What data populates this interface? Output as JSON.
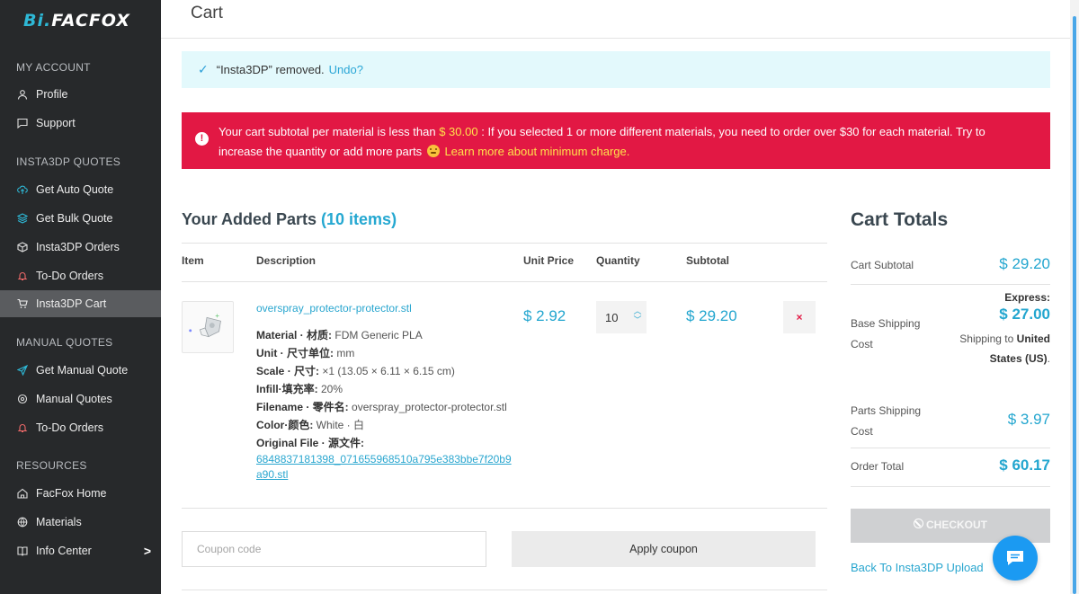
{
  "brand": {
    "logo_prefix": "Bi.",
    "logo_main": "FACFOX"
  },
  "sidebar": {
    "sections": [
      {
        "title": "MY ACCOUNT",
        "items": [
          {
            "label": "Profile",
            "icon": "user-icon"
          },
          {
            "label": "Support",
            "icon": "chat-icon"
          }
        ]
      },
      {
        "title": "INSTA3DP QUOTES",
        "items": [
          {
            "label": "Get Auto Quote",
            "icon": "cloud-upload-icon"
          },
          {
            "label": "Get Bulk Quote",
            "icon": "layers-icon"
          },
          {
            "label": "Insta3DP Orders",
            "icon": "box-icon"
          },
          {
            "label": "To-Do Orders",
            "icon": "bell-icon"
          },
          {
            "label": "Insta3DP Cart",
            "icon": "cart-icon",
            "active": true
          }
        ]
      },
      {
        "title": "MANUAL QUOTES",
        "items": [
          {
            "label": "Get Manual Quote",
            "icon": "send-icon"
          },
          {
            "label": "Manual Quotes",
            "icon": "gear-icon"
          },
          {
            "label": "To-Do Orders",
            "icon": "bell-icon"
          }
        ]
      },
      {
        "title": "RESOURCES",
        "items": [
          {
            "label": "FacFox Home",
            "icon": "home-icon"
          },
          {
            "label": "Materials",
            "icon": "globe-icon"
          },
          {
            "label": "Info Center",
            "icon": "book-icon",
            "chevron": ">"
          }
        ]
      }
    ]
  },
  "header": {
    "title": "Cart"
  },
  "notice_info": {
    "text": "“Insta3DP” removed.",
    "undo_label": "Undo?"
  },
  "notice_error": {
    "text_before": "Your cart subtotal per material is less than",
    "amount": "$ 30.00",
    "text_after": ": If you selected 1 or more different materials, you need to order over $30 for each material. Try to increase the quantity or add more parts",
    "link": "Learn more about minimum charge."
  },
  "parts": {
    "heading": "Your Added Parts",
    "count": "(10 items)",
    "columns": {
      "item": "Item",
      "description": "Description",
      "unit_price": "Unit Price",
      "quantity": "Quantity",
      "subtotal": "Subtotal"
    },
    "rows": [
      {
        "name": "overspray_protector-protector.stl",
        "meta": [
          {
            "key": "Material · 材质:",
            "value": "FDM Generic PLA"
          },
          {
            "key": "Unit · 尺寸单位:",
            "value": "mm"
          },
          {
            "key": "Scale · 尺寸:",
            "value": "×1 (13.05 × 6.11 × 6.15 cm)"
          },
          {
            "key": "Infill·填充率:",
            "value": "20%"
          },
          {
            "key": "Filename · 零件名:",
            "value": "overspray_protector-protector.stl"
          },
          {
            "key": "Color·颜色:",
            "value": "White · 白"
          },
          {
            "key": "Original File · 源文件:",
            "value": ""
          }
        ],
        "original_file": "6848837181398_071655968510a795e383bbe7f20b9a90.stl",
        "unit_price": "$ 2.92",
        "quantity": "10",
        "subtotal": "$ 29.20",
        "remove_label": "×"
      }
    ]
  },
  "coupon": {
    "placeholder": "Coupon code",
    "apply_label": "Apply coupon"
  },
  "totals": {
    "heading": "Cart Totals",
    "subtotal_label": "Cart Subtotal",
    "subtotal_value": "$ 29.20",
    "base_shipping_label_1": "Base Shipping",
    "base_shipping_label_2": "Cost",
    "express_label": "Express:",
    "base_shipping_value": "$ 27.00",
    "ship_note_prefix": "Shipping to",
    "ship_note_dest_1": "United",
    "ship_note_dest_2": "States (US)",
    "parts_shipping_label_1": "Parts Shipping",
    "parts_shipping_label_2": "Cost",
    "parts_shipping_value": "$ 3.97",
    "order_total_label": "Order Total",
    "order_total_value": "$ 60.17",
    "checkout_label": "CHECKOUT",
    "back_link": "Back To Insta3DP Upload"
  },
  "colors": {
    "accent": "#25a8d1",
    "error": "#e21844",
    "sidebar_bg": "#27292b"
  }
}
